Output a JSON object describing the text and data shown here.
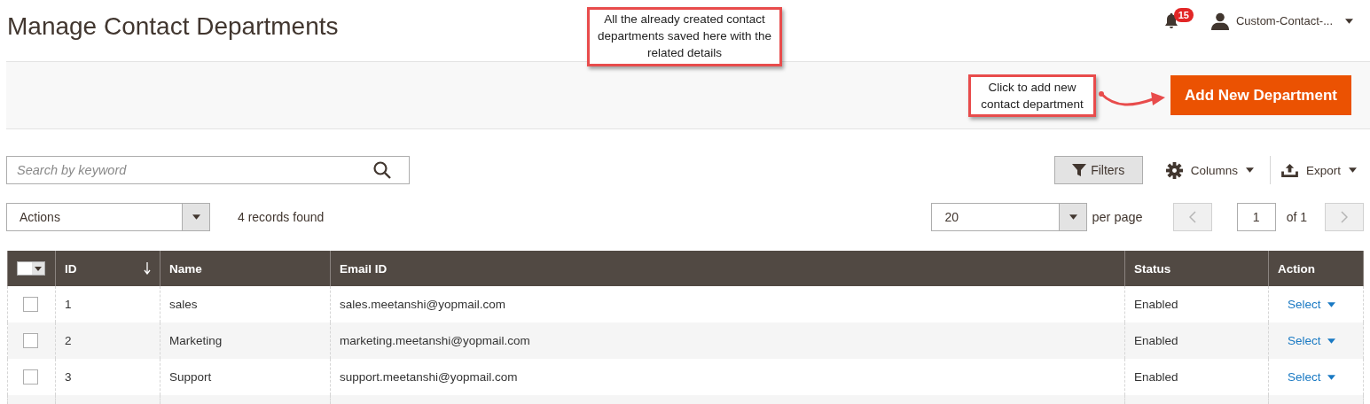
{
  "page_title": "Manage Contact Departments",
  "notifications": {
    "count": "15"
  },
  "user": {
    "name": "Custom-Contact-..."
  },
  "callouts": [
    {
      "kind": "top",
      "text": "All the already created contact departments saved here with the related details"
    },
    {
      "kind": "button",
      "text": "Click to add new contact department"
    }
  ],
  "add_button": "Add New Department",
  "search": {
    "placeholder": "Search by keyword"
  },
  "toolbar": {
    "filters": "Filters",
    "columns": "Columns",
    "export": "Export"
  },
  "actions": {
    "value": "Actions"
  },
  "records_found": "4 records found",
  "pager": {
    "per_page_value": "20",
    "per_page_label": "per page",
    "page": "1",
    "of": "of 1"
  },
  "table": {
    "mass_select": {
      "checked": false
    },
    "columns": [
      {
        "label": "ID",
        "sorted": true
      },
      {
        "label": "Name",
        "sorted": false
      },
      {
        "label": "Email ID",
        "sorted": false
      },
      {
        "label": "Status",
        "sorted": false
      },
      {
        "label": "Action",
        "sorted": false
      }
    ],
    "rows": [
      {
        "checked": false,
        "id": "1",
        "name": "sales",
        "email": "sales.meetanshi@yopmail.com",
        "status": "Enabled",
        "action": "Select"
      },
      {
        "checked": false,
        "id": "2",
        "name": "Marketing",
        "email": "marketing.meetanshi@yopmail.com",
        "status": "Enabled",
        "action": "Select"
      },
      {
        "checked": false,
        "id": "3",
        "name": "Support",
        "email": "support.meetanshi@yopmail.com",
        "status": "Enabled",
        "action": "Select"
      }
    ]
  }
}
